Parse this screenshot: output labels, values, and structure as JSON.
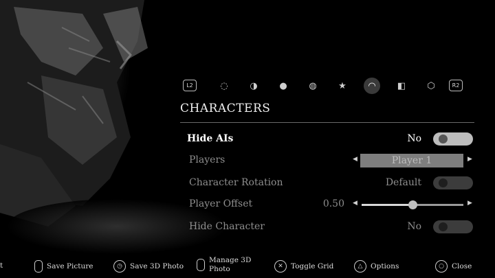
{
  "tabs": {
    "left_bumper": "L2",
    "right_bumper": "R2",
    "items": [
      {
        "icon": "camera-lens-icon",
        "glyph": "◌"
      },
      {
        "icon": "exposure-icon",
        "glyph": "◑"
      },
      {
        "icon": "color-filter-icon",
        "glyph": "●"
      },
      {
        "icon": "aperture-icon",
        "glyph": "◍"
      },
      {
        "icon": "star-effects-icon",
        "glyph": "★"
      },
      {
        "icon": "characters-icon",
        "glyph": "◠"
      },
      {
        "icon": "frame-icon",
        "glyph": "◧"
      },
      {
        "icon": "shape-icon",
        "glyph": "⬡"
      }
    ],
    "active_index": 5
  },
  "section": {
    "title": "CHARACTERS"
  },
  "settings": {
    "hide_ais": {
      "label": "Hide AIs",
      "value": "No"
    },
    "players": {
      "label": "Players",
      "value": "Player 1"
    },
    "character_rotation": {
      "label": "Character Rotation",
      "value": "Default"
    },
    "player_offset": {
      "label": "Player Offset",
      "value": "0.50",
      "level": 0.5
    },
    "hide_character": {
      "label": "Hide Character",
      "value": "No"
    }
  },
  "bottombar": {
    "partial_left": "t",
    "save_picture": "Save Picture",
    "save_3d_photo": "Save 3D Photo",
    "manage_3d_line1": "Manage 3D",
    "manage_3d_line2": "Photo",
    "toggle_grid": "Toggle Grid",
    "options": "Options",
    "close": "Close"
  },
  "colors": {
    "accent": "#ffffff",
    "muted": "#8e8e8e",
    "selector_bg": "#7e7e7e"
  }
}
